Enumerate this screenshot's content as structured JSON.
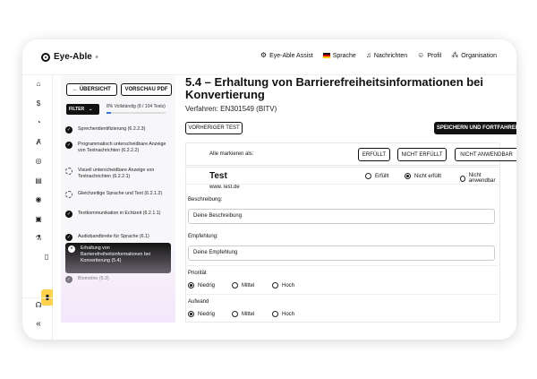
{
  "header": {
    "logo": "Eye-Able",
    "nav": [
      {
        "label": "Eye-Able Assist",
        "icon": "gear-icon"
      },
      {
        "label": "Sprache",
        "icon": "german-flag-icon"
      },
      {
        "label": "Nachrichten",
        "icon": "bell-icon"
      },
      {
        "label": "Profil",
        "icon": "user-icon"
      },
      {
        "label": "Organisation",
        "icon": "organisation-icon"
      }
    ]
  },
  "rail": {
    "icons": [
      "home-icon",
      "dollar-icon",
      "clock-icon",
      "translate-icon",
      "fingerprint-icon",
      "clipboard-icon",
      "target-icon",
      "pdf-icon",
      "flask-icon",
      "document-icon",
      "clipboard-active-icon",
      "support-icon",
      "collapse-icon"
    ]
  },
  "panel": {
    "back_label": "← ÜBERSICHT",
    "preview_label": "VORSCHAU PDF",
    "filter_label": "FILTER",
    "progress_text": "8% Vollständig (8 / 104 Tests)",
    "progress_value": 0.08,
    "items": [
      {
        "text": "Sprecheridentifizierung (6.2.2.3)",
        "state": "done"
      },
      {
        "text": "Programmatisch unterscheidbare Anzeige von Textnachrichten (6.2.2.2)",
        "state": "done"
      },
      {
        "text": "Visuell unterscheidbare Anzeige von Textnachrichten (6.2.2.1)",
        "state": "open"
      },
      {
        "text": "Gleichzeitige Sprache und Text (6.2.1.2)",
        "state": "open"
      },
      {
        "text": "Textkommunikation in Echtzeit (6.2.1.1)",
        "state": "done"
      },
      {
        "text": "Audiobandbreite für Sprache (6.1)",
        "state": "done"
      },
      {
        "text": "Erhaltung von Barrierefreiheitsinformationen bei Konvertierung (5.4)",
        "state": "active"
      },
      {
        "text": "Biometrie (5.3)",
        "state": "done"
      }
    ]
  },
  "main": {
    "title": "5.4 – Erhaltung von Barrierefreiheitsinformationen bei Konvertierung",
    "verfahren": "Verfahren: EN301549 (BITV)",
    "prev_test": "VORHERIGER TEST",
    "save_next": "SPEICHERN UND FORTFAHREN",
    "mark_all": "Alle markieren als:",
    "mark_buttons": [
      "ERFÜLLT",
      "NICHT ERFÜLLT",
      "NICHT ANWENDBAR"
    ],
    "test_title": "Test",
    "test_url": "www.Test.de",
    "test_options": [
      "Erfüllt",
      "Nicht erfüllt",
      "Nicht anwendbar"
    ],
    "test_selected": "Nicht erfüllt",
    "beschreibung_label": "Beschreibung:",
    "beschreibung_value": "Deine Beschreibung",
    "empfehlung_label": "Empfehlung:",
    "empfehlung_value": "Deine Empfehlung",
    "prioritaet_label": "Priorität",
    "aufwand_label": "Aufwand",
    "levels": [
      "Niedrig",
      "Mittel",
      "Hoch"
    ],
    "prioritaet_selected": "Niedrig",
    "aufwand_selected": "Niedrig"
  }
}
